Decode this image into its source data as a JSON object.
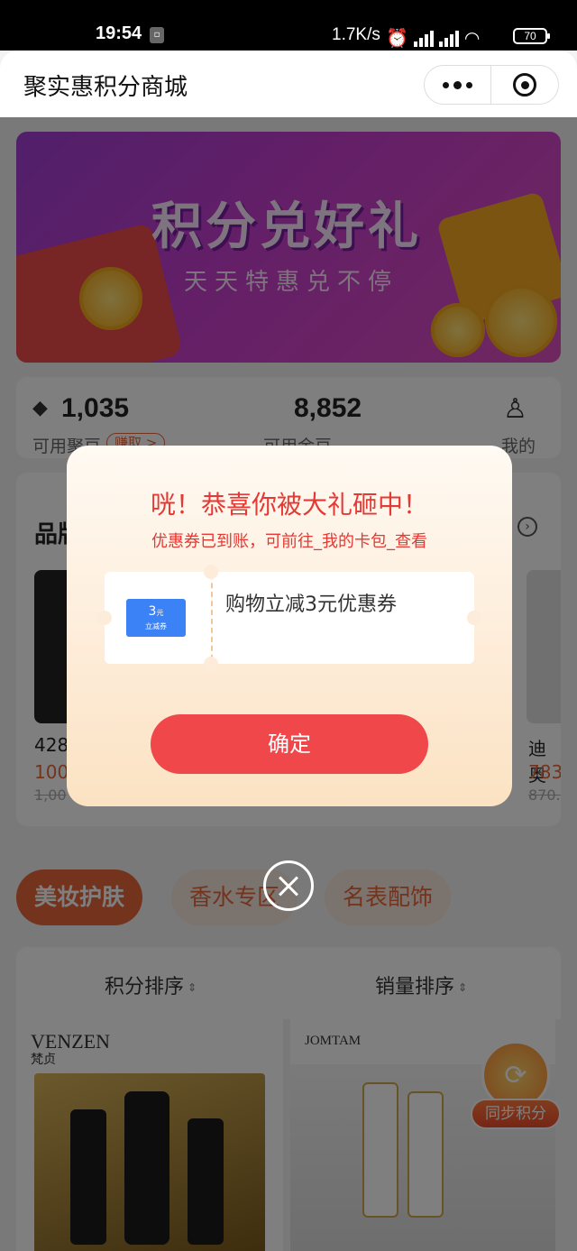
{
  "status_bar": {
    "time": "19:54",
    "network_speed": "1.7K/s",
    "battery": "70"
  },
  "titlebar": {
    "title": "聚实惠积分商城"
  },
  "banner": {
    "title": "积分兑好礼",
    "subtitle": "天天特惠兑不停"
  },
  "stats": {
    "points_value": "1,035",
    "points_label": "可用聚豆",
    "earn_label": "赚取 >",
    "gold_value": "8,852",
    "gold_label": "可用金豆",
    "mine_label": "我的"
  },
  "section": {
    "title": "品牌",
    "products": [
      {
        "name": "428",
        "price": "100",
        "old_price": "1,00"
      },
      {
        "name": "迪奥",
        "price": "783",
        "old_price": "870."
      }
    ]
  },
  "categories": [
    "美妆护肤",
    "香水专区",
    "名表配饰"
  ],
  "sort": {
    "by_points": "积分排序",
    "by_sales": "销量排序"
  },
  "products_grid": [
    {
      "brand": "VENZEN",
      "brand_cn": "梵贞"
    },
    {
      "brand": "JOMTAM"
    }
  ],
  "sync_button": {
    "label": "同步积分"
  },
  "modal": {
    "headline": "咣！恭喜你被大礼砸中！",
    "subline": "优惠券已到账，可前往_我的卡包_查看",
    "coupon_amount": "3",
    "coupon_unit": "元",
    "coupon_tag": "立减券",
    "coupon_name": "购物立减3元优惠券",
    "confirm_label": "确定"
  },
  "colors": {
    "accent": "#e8663a",
    "modal_red": "#e53935",
    "confirm_button": "#f0474b",
    "coupon_blue": "#3b82f6"
  }
}
